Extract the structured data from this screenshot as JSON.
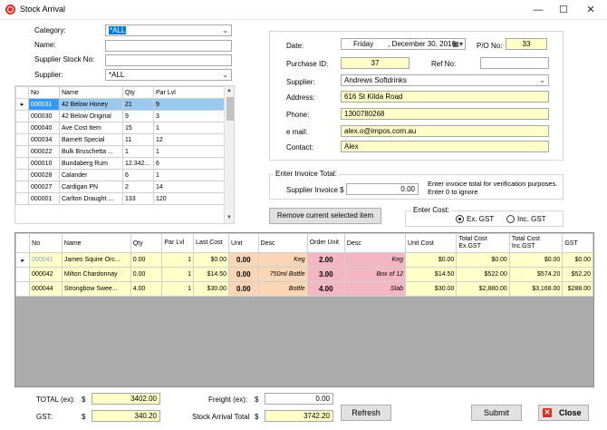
{
  "window": {
    "title": "Stock Arrival",
    "minimize": "—",
    "maximize": "☐",
    "close": "✕"
  },
  "filters": {
    "category_label": "Category:",
    "category_value": "*ALL",
    "name_label": "Name:",
    "name_value": "",
    "supplier_stock_label": "Supplier Stock No:",
    "supplier_stock_value": "",
    "supplier_label": "Supplier:",
    "supplier_value": "*ALL"
  },
  "stock_grid": {
    "columns": [
      "No",
      "Name",
      "Qty",
      "Par Lvl"
    ],
    "rows": [
      [
        "000031",
        "42 Below Honey",
        "21",
        "9"
      ],
      [
        "000030",
        "42 Below Original",
        "9",
        "3"
      ],
      [
        "000040",
        "Ave Cost Item",
        "15",
        "1"
      ],
      [
        "000034",
        "Barnett Special",
        "11",
        "12"
      ],
      [
        "000022",
        "Bulk Bruschetta ...",
        "1",
        "1"
      ],
      [
        "000010",
        "Bundaberg Rum",
        "12.342...",
        "6"
      ],
      [
        "000028",
        "Calander",
        "6",
        "1"
      ],
      [
        "000027",
        "Cardigan PN",
        "2",
        "14"
      ],
      [
        "000001",
        "Carlton Draught ...",
        "133",
        "120"
      ]
    ]
  },
  "order": {
    "date_label": "Date:",
    "date_day": "Friday",
    "date_value": ", December 30, 2016",
    "po_label": "P/O No:",
    "po_value": "33",
    "purchase_id_label": "Purchase ID:",
    "purchase_id_value": "37",
    "ref_label": "Ref No:",
    "ref_value": "",
    "supplier_label": "Supplier:",
    "supplier_value": "Andrews Softdrinks",
    "address_label": "Address:",
    "address_value": "616 St Kilda Road",
    "phone_label": "Phone:",
    "phone_value": "1300780268",
    "email_label": "e mail:",
    "email_value": "alex.o@impos.com.au",
    "contact_label": "Contact:",
    "contact_value": "Alex"
  },
  "invoice": {
    "group_label": "Enter Invoice Total:",
    "supplier_invoice_label": "Supplier Invoice $",
    "supplier_invoice_value": "0.00",
    "hint": "Enter invoice total for verification purposes. Enter 0 to ignore"
  },
  "remove_button": "Remove current selected item",
  "cost": {
    "group_label": "Enter Cost:",
    "ex_gst": "Ex. GST",
    "inc_gst": "Inc. GST"
  },
  "arrival_grid": {
    "columns": [
      "No",
      "Name",
      "Qty",
      "Par Lvl",
      "Last Cost",
      "Unit",
      "Desc",
      "Order Unit",
      "Desc",
      "Unit Cost",
      "Total Cost Ex.GST",
      "Total Cost Inc.GST",
      "GST"
    ],
    "rows": [
      [
        "000041",
        "James Squire Orc...",
        "0.00",
        "1",
        "$0.00",
        "0.00",
        "Keg",
        "2.00",
        "Keg",
        "$0.00",
        "$0.00",
        "$0.00",
        "$0.00"
      ],
      [
        "000042",
        "Milton Chardonnay",
        "0.00",
        "1",
        "$14.50",
        "0.00",
        "750ml Bottle",
        "3.00",
        "Box of 12",
        "$14.50",
        "$522.00",
        "$574.20",
        "$52.20"
      ],
      [
        "000044",
        "Strongbow Swee...",
        "4.00",
        "1",
        "$30.00",
        "0.00",
        "Bottle",
        "4.00",
        "Slab",
        "$30.00",
        "$2,880.00",
        "$3,168.00",
        "$288.00"
      ]
    ]
  },
  "footer": {
    "total_ex_label": "TOTAL (ex):",
    "total_ex_currency": "$",
    "total_ex_value": "3402.00",
    "gst_label": "GST:",
    "gst_currency": "$",
    "gst_value": "340.20",
    "freight_label": "Freight (ex):",
    "freight_currency": "$",
    "freight_value": "0.00",
    "arrival_total_label": "Stock Arrival Total",
    "arrival_total_currency": "$",
    "arrival_total_value": "3742.20",
    "refresh": "Refresh",
    "submit": "Submit",
    "close": "Close"
  }
}
